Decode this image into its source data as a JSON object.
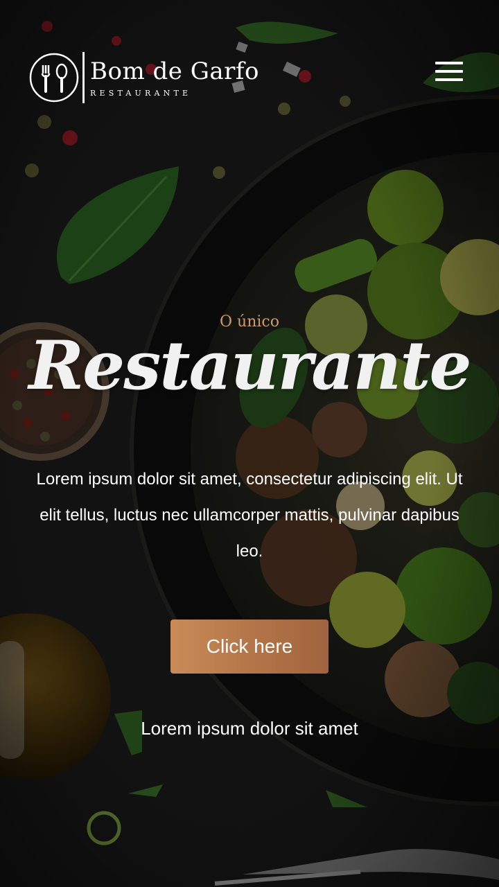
{
  "colors": {
    "accent": "#d19a66",
    "button_start": "#c98b57",
    "button_end": "#a0643f",
    "background": "#1b1a19",
    "top_line": "#8a1f2a"
  },
  "header": {
    "logo_icon": "fork-spoon-icon",
    "brand_name": "Bom de Garfo",
    "brand_sub": "RESTAURANTE",
    "menu_icon": "hamburger-icon"
  },
  "hero": {
    "eyebrow": "O único",
    "title": "Restaurante",
    "body": "Lorem ipsum dolor sit amet, consectetur adipiscing elit. Ut elit tellus, luctus nec ullamcorper mattis, pulvinar dapibus leo.",
    "button_label": "Click here",
    "subline": "Lorem ipsum dolor sit amet"
  }
}
